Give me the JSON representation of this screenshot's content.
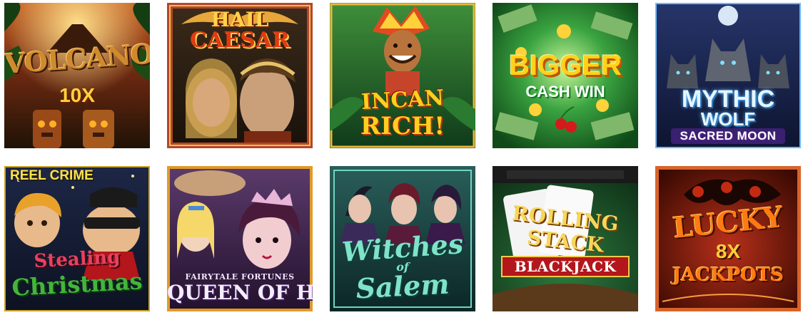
{
  "games": {
    "volcano_blast": {
      "line1": "VOLCANO BLAST",
      "line2": "10X"
    },
    "hail_caesar": {
      "line1": "HAIL",
      "line2": "CAESAR"
    },
    "incan_rich": {
      "line1": "INCAN",
      "line2": "RICH!"
    },
    "bigger_cash_win": {
      "line1": "BIGGER",
      "line2": "CASH WIN"
    },
    "mythic_wolf": {
      "line1": "MYTHIC",
      "line2": "WOLF",
      "line3": "SACRED MOON"
    },
    "stealing_christmas": {
      "brand": "REEL CRIME",
      "line1": "Stealing",
      "line2": "Christmas"
    },
    "queen_of_hearts": {
      "brand": "FAIRYTALE FORTUNES",
      "line1": "QUEEN OF HEARTS"
    },
    "witches_of_salem": {
      "line1": "Witches",
      "line2": "of",
      "line3": "Salem"
    },
    "rolling_stack_blackjack": {
      "line1": "ROLLING",
      "line2": "STACK",
      "line3": "BLACKJACK"
    },
    "lucky_8x_jackpots": {
      "line1": "LUCKY",
      "line2": "8X",
      "line3": "JACKPOTS"
    }
  },
  "colors": {
    "page_background": "#ffffff",
    "volcano_sky": "#8a3a12",
    "caesar_border": "#b5462a",
    "incan_jungle": "#1f7a33",
    "cash_green": "#1f8a2d",
    "wolf_night": "#1c2a55",
    "crime_night": "#1a2340",
    "queen_purple": "#3a1d4e",
    "witch_teal": "#0f4a4a",
    "blackjack_felt": "#1e5a2e",
    "lucky_red": "#7a1500"
  }
}
